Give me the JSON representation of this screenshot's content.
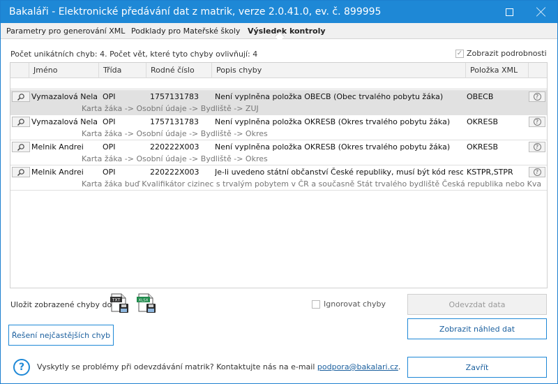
{
  "window": {
    "title": "Bakaláři - Elektronické předávání dat z matrik, verze 2.0.41.0, ev. č. 899995"
  },
  "tabs": [
    {
      "label": "Parametry pro generování XML"
    },
    {
      "label": "Podklady pro Mateřské školy"
    },
    {
      "label": "Výsledek kontroly"
    }
  ],
  "summary": {
    "text": "Počet unikátních chyb: 4. Počet vět, které tyto chyby ovlivňují: 4",
    "show_details_label": "Zobrazit podrobnosti",
    "show_details_checked": true
  },
  "grid": {
    "columns": [
      "Jméno",
      "Třída",
      "Rodné číslo",
      "Popis chyby",
      "Položka XML"
    ],
    "rows": [
      {
        "name": "Vymazalová Nela",
        "class": "OPI",
        "birth_number": "1757131783",
        "description": "Není vyplněna položka OBECB (Obec trvalého pobytu žáka)",
        "xml_item": "OBECB",
        "detail": "Karta žáka -> Osobní údaje -> Bydliště -> ZUJ",
        "selected": true
      },
      {
        "name": "Vymazalová Nela",
        "class": "OPI",
        "birth_number": "1757131783",
        "description": "Není vyplněna položka OKRESB (Okres trvalého pobytu žáka)",
        "xml_item": "OKRESB",
        "detail": "Karta žáka -> Osobní údaje -> Bydliště -> Okres",
        "selected": false
      },
      {
        "name": "Melnik Andrei",
        "class": "OPI",
        "birth_number": "220222X003",
        "description": "Není vyplněna položka OKRESB (Okres trvalého pobytu žáka)",
        "xml_item": "OKRESB",
        "detail": "Karta žáka -> Osobní údaje -> Bydliště -> Okres",
        "selected": false
      },
      {
        "name": "Melnik Andrei",
        "class": "OPI",
        "birth_number": "220222X003",
        "description": "Je-li uvedeno státní občanství České republiky, musí být kód resort...",
        "xml_item": "KSTPR,STPR",
        "detail": "Karta žáka buď  Kvalifikátor cizinec s trvalým pobytem v ČR a současně Stát trvalého bydliště Česká republika nebo Kvalifikátor...",
        "selected": false
      }
    ]
  },
  "bottom": {
    "save_label": "Uložit zobrazené chyby do:",
    "txt_label": "TXT",
    "xlsx_label": "XLSX",
    "ignore_label": "Ignorovat chyby",
    "ignore_checked": false,
    "send_button": "Odevzdat data",
    "preview_button": "Zobrazit náhled dat",
    "solutions_button": "Řešení nejčastějších chyb",
    "close_button": "Zavřít",
    "help_text": "Vyskytly se problémy při odevzdávání matrik?  Kontaktujte nás na e-mail ",
    "help_email": "podpora@bakalari.cz",
    "help_end": "."
  },
  "colors": {
    "accent": "#1e88d6",
    "selected_row": "#e1e1e1",
    "disabled_button": "#f1f1f1"
  },
  "icons": [
    "maximize-icon",
    "close-icon",
    "magnifier-icon",
    "question-icon",
    "txt-file-icon",
    "xlsx-file-icon",
    "help-icon"
  ]
}
